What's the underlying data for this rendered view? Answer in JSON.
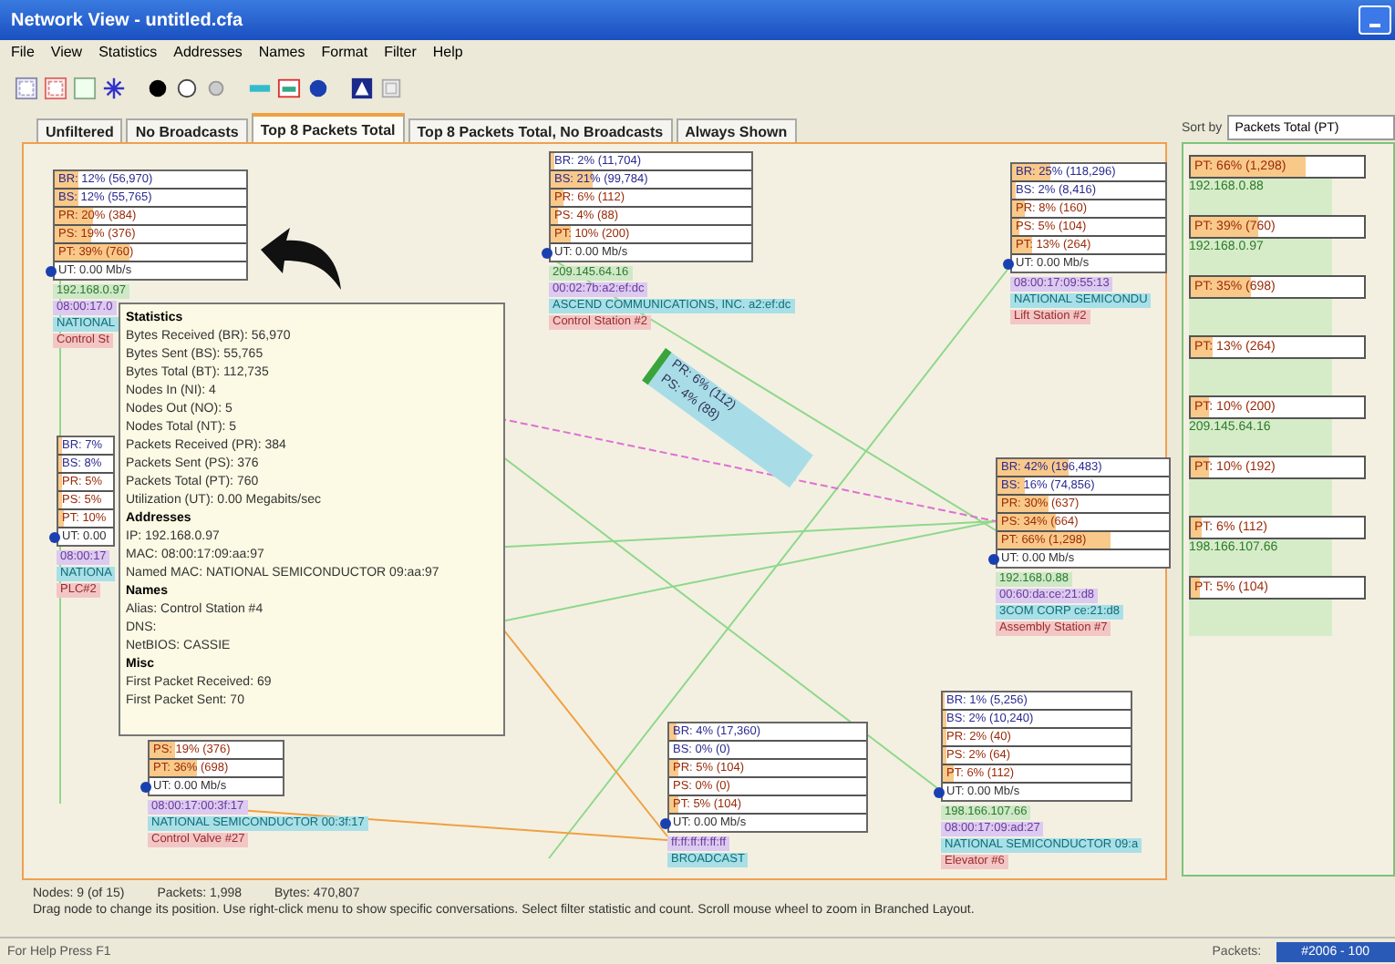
{
  "window": {
    "title": "Network View - untitled.cfa"
  },
  "menu": [
    "File",
    "View",
    "Statistics",
    "Addresses",
    "Names",
    "Format",
    "Filter",
    "Help"
  ],
  "tabs": [
    {
      "label": "Unfiltered",
      "selected": false
    },
    {
      "label": "No Broadcasts",
      "selected": false
    },
    {
      "label": "Top 8 Packets Total",
      "selected": true
    },
    {
      "label": "Top 8 Packets Total, No Broadcasts",
      "selected": false
    },
    {
      "label": "Always Shown",
      "selected": false
    }
  ],
  "nodes": [
    {
      "rows": [
        {
          "kind": "bytes",
          "text": "BR: 12% (56,970)",
          "level": 0.12
        },
        {
          "kind": "bytes",
          "text": "BS: 12% (55,765)",
          "level": 0.12
        },
        {
          "kind": "packets",
          "text": "PR: 20% (384)",
          "level": 0.2
        },
        {
          "kind": "packets",
          "text": "PS: 19% (376)",
          "level": 0.19
        },
        {
          "kind": "packets",
          "text": "PT: 39% (760)",
          "level": 0.39
        },
        {
          "kind": "util",
          "text": "UT: 0.00 Mb/s"
        }
      ],
      "labels": [
        {
          "kind": "ip",
          "text": "192.168.0.97"
        },
        {
          "kind": "mac",
          "text": "08:00:17.0"
        },
        {
          "kind": "vendor",
          "text": "NATIONAL"
        },
        {
          "kind": "alias",
          "text": "Control St"
        }
      ]
    },
    {
      "rows": [
        {
          "kind": "bytes",
          "text": "BR: 2% (11,704)",
          "level": 0.02
        },
        {
          "kind": "bytes",
          "text": "BS: 21% (99,784)",
          "level": 0.21
        },
        {
          "kind": "packets",
          "text": "PR: 6% (112)",
          "level": 0.06
        },
        {
          "kind": "packets",
          "text": "PS: 4% (88)",
          "level": 0.04
        },
        {
          "kind": "packets",
          "text": "PT: 10% (200)",
          "level": 0.1
        },
        {
          "kind": "util",
          "text": "UT: 0.00 Mb/s"
        }
      ],
      "labels": [
        {
          "kind": "ip",
          "text": "209.145.64.16"
        },
        {
          "kind": "mac",
          "text": "00:02:7b:a2:ef:dc"
        },
        {
          "kind": "vendor",
          "text": "ASCEND COMMUNICATIONS, INC. a2:ef:dc"
        },
        {
          "kind": "alias",
          "text": "Control Station #2"
        }
      ]
    },
    {
      "rows": [
        {
          "kind": "bytes",
          "text": "BR: 25% (118,296)",
          "level": 0.25
        },
        {
          "kind": "bytes",
          "text": "BS: 2% (8,416)",
          "level": 0.02
        },
        {
          "kind": "packets",
          "text": "PR: 8% (160)",
          "level": 0.08
        },
        {
          "kind": "packets",
          "text": "PS: 5% (104)",
          "level": 0.05
        },
        {
          "kind": "packets",
          "text": "PT: 13% (264)",
          "level": 0.13
        },
        {
          "kind": "util",
          "text": "UT: 0.00 Mb/s"
        }
      ],
      "labels": [
        {
          "kind": "mac",
          "text": "08:00:17:09:55:13"
        },
        {
          "kind": "vendor",
          "text": "NATIONAL SEMICONDU"
        },
        {
          "kind": "alias",
          "text": "Lift Station #2"
        }
      ]
    },
    {
      "rows": [
        {
          "kind": "bytes",
          "text": "BR: 7%",
          "level": 0.07
        },
        {
          "kind": "bytes",
          "text": "BS: 8%",
          "level": 0.08
        },
        {
          "kind": "packets",
          "text": "PR: 5%",
          "level": 0.05
        },
        {
          "kind": "packets",
          "text": "PS: 5%",
          "level": 0.05
        },
        {
          "kind": "packets",
          "text": "PT: 10%",
          "level": 0.1
        },
        {
          "kind": "util",
          "text": "UT: 0.00"
        }
      ],
      "labels": [
        {
          "kind": "mac",
          "text": "08:00:17"
        },
        {
          "kind": "vendor",
          "text": "NATIONA"
        },
        {
          "kind": "alias",
          "text": "PLC#2"
        }
      ]
    },
    {
      "rows": [
        {
          "kind": "packets",
          "text": "PS: 19% (376)",
          "level": 0.19
        },
        {
          "kind": "packets",
          "text": "PT: 36% (698)",
          "level": 0.36
        },
        {
          "kind": "util",
          "text": "UT: 0.00 Mb/s"
        }
      ],
      "labels": [
        {
          "kind": "mac",
          "text": "08:00:17:00:3f:17"
        },
        {
          "kind": "vendor",
          "text": "NATIONAL SEMICONDUCTOR 00:3f:17"
        },
        {
          "kind": "alias",
          "text": "Control Valve #27"
        }
      ]
    },
    {
      "rows": [
        {
          "kind": "bytes",
          "text": "BR: 4% (17,360)",
          "level": 0.04
        },
        {
          "kind": "bytes",
          "text": "BS: 0% (0)"
        },
        {
          "kind": "packets",
          "text": "PR: 5% (104)",
          "level": 0.05
        },
        {
          "kind": "packets",
          "text": "PS: 0% (0)"
        },
        {
          "kind": "packets",
          "text": "PT: 5% (104)",
          "level": 0.05
        },
        {
          "kind": "util",
          "text": "UT: 0.00 Mb/s"
        }
      ],
      "labels": [
        {
          "kind": "mac",
          "text": "ff:ff:ff:ff:ff:ff"
        },
        {
          "kind": "vendor",
          "text": "BROADCAST"
        }
      ]
    },
    {
      "rows": [
        {
          "kind": "bytes",
          "text": "BR: 42% (196,483)",
          "level": 0.42
        },
        {
          "kind": "bytes",
          "text": "BS: 16% (74,856)",
          "level": 0.16
        },
        {
          "kind": "packets",
          "text": "PR: 30% (637)",
          "level": 0.3
        },
        {
          "kind": "packets",
          "text": "PS: 34% (664)",
          "level": 0.34
        },
        {
          "kind": "packets",
          "text": "PT: 66% (1,298)",
          "level": 0.66
        },
        {
          "kind": "util",
          "text": "UT: 0.00 Mb/s"
        }
      ],
      "labels": [
        {
          "kind": "ip",
          "text": "192.168.0.88"
        },
        {
          "kind": "mac",
          "text": "00:60:da:ce:21:d8"
        },
        {
          "kind": "vendor",
          "text": "3COM CORP ce:21:d8"
        },
        {
          "kind": "alias",
          "text": "Assembly Station #7"
        }
      ]
    },
    {
      "rows": [
        {
          "kind": "bytes",
          "text": "BR: 1% (5,256)",
          "level": 0.01
        },
        {
          "kind": "bytes",
          "text": "BS: 2% (10,240)",
          "level": 0.02
        },
        {
          "kind": "packets",
          "text": "PR: 2% (40)",
          "level": 0.02
        },
        {
          "kind": "packets",
          "text": "PS: 2% (64)",
          "level": 0.02
        },
        {
          "kind": "packets",
          "text": "PT: 6% (112)",
          "level": 0.06
        },
        {
          "kind": "util",
          "text": "UT: 0.00 Mb/s"
        }
      ],
      "labels": [
        {
          "kind": "ip",
          "text": "198.166.107.66"
        },
        {
          "kind": "mac",
          "text": "08:00:17:09:ad:27"
        },
        {
          "kind": "vendor",
          "text": "NATIONAL SEMICONDUCTOR 09:a"
        },
        {
          "kind": "alias",
          "text": "Elevator #6"
        }
      ]
    }
  ],
  "link": {
    "lines": [
      "PR: 6% (112)",
      "PS: 4% (88)"
    ]
  },
  "tooltip": {
    "sections": [
      {
        "heading": "Statistics",
        "lines": [
          "Bytes Received (BR): 56,970",
          "Bytes Sent (BS): 55,765",
          "Bytes Total (BT): 112,735",
          "Nodes In (NI): 4",
          "Nodes Out (NO): 5",
          "Nodes Total (NT): 5",
          "Packets Received (PR): 384",
          "Packets Sent (PS): 376",
          "Packets Total (PT): 760",
          "Utilization (UT): 0.00 Megabits/sec"
        ]
      },
      {
        "heading": "Addresses",
        "lines": [
          "IP: 192.168.0.97",
          "MAC: 08:00:17:09:aa:97",
          "Named MAC: NATIONAL SEMICONDUCTOR 09:aa:97"
        ]
      },
      {
        "heading": "Names",
        "lines": [
          "Alias: Control Station #4",
          "DNS:",
          "NetBIOS: CASSIE"
        ]
      },
      {
        "heading": "Misc",
        "lines": [
          "First Packet Received: 69",
          "First Packet Sent: 70"
        ]
      }
    ]
  },
  "sort": {
    "label": "Sort by",
    "value": "Packets Total (PT)"
  },
  "ranking": [
    {
      "text": "PT: 66% (1,298)",
      "level": 0.66,
      "ip": "192.168.0.88"
    },
    {
      "text": "PT: 39% (760)",
      "level": 0.39,
      "ip": "192.168.0.97"
    },
    {
      "text": "PT: 35% (698)",
      "level": 0.35
    },
    {
      "text": "PT: 13% (264)",
      "level": 0.13
    },
    {
      "text": "PT: 10% (200)",
      "level": 0.1,
      "ip": "209.145.64.16"
    },
    {
      "text": "PT: 10% (192)",
      "level": 0.1
    },
    {
      "text": "PT: 6% (112)",
      "level": 0.06,
      "ip": "198.166.107.66"
    },
    {
      "text": "PT: 5% (104)",
      "level": 0.05
    }
  ],
  "summary": [
    "Nodes: 9 (of 15)",
    "Packets: 1,998",
    "Bytes: 470,807"
  ],
  "hint": "Drag node to change its position.  Use right-click menu to show specific conversations.  Select filter statistic and count.  Scroll mouse wheel to zoom in Branched Layout.",
  "status_bar": {
    "help": "For Help Press F1",
    "packets_label": "Packets:",
    "packets_value": "#2006 - 100"
  }
}
